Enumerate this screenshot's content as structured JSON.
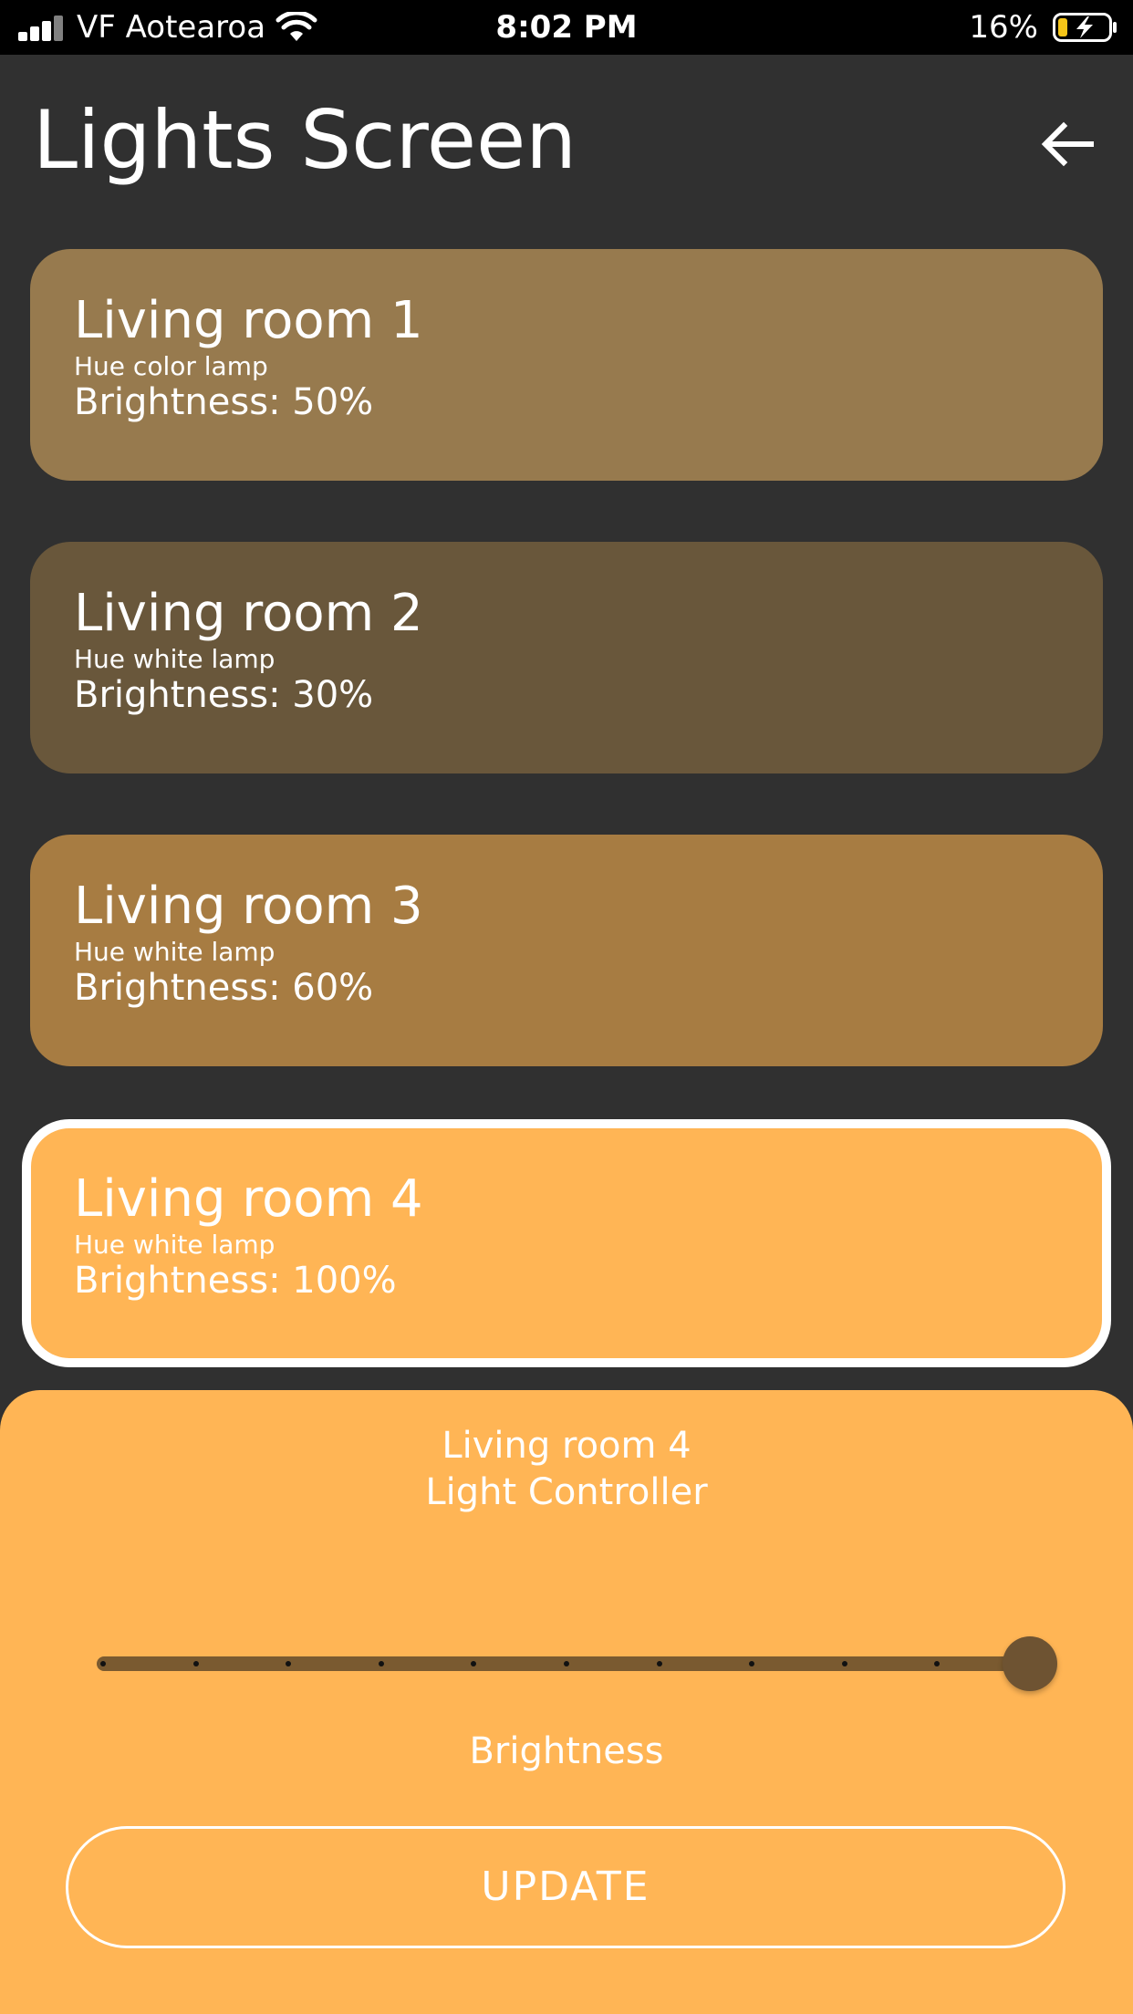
{
  "status_bar": {
    "carrier": "VF Aotearoa",
    "time": "8:02 PM",
    "battery_percent": "16%",
    "icons": [
      "signal-icon",
      "wifi-icon",
      "battery-charging-icon"
    ]
  },
  "header": {
    "title": "Lights Screen",
    "back_icon": "arrow-left-icon"
  },
  "lights": [
    {
      "name": "Living room 1",
      "type": "Hue color lamp",
      "brightness": "Brightness: 50%",
      "color": "#977a4e",
      "selected": false
    },
    {
      "name": "Living room 2",
      "type": "Hue white lamp",
      "brightness": "Brightness: 30%",
      "color": "#69573b",
      "selected": false
    },
    {
      "name": "Living room 3",
      "type": "Hue white lamp",
      "brightness": "Brightness: 60%",
      "color": "#a77c42",
      "selected": false
    },
    {
      "name": "Living room 4",
      "type": "Hue white lamp",
      "brightness": "Brightness: 100%",
      "color": "#ffb555",
      "selected": true
    }
  ],
  "controller": {
    "title_line1": "Living room 4",
    "title_line2": "Light Controller",
    "slider_label": "Brightness",
    "slider_value": 1.0,
    "slider_divisions": 10,
    "update_label": "UPDATE"
  },
  "colors": {
    "background": "#303030",
    "accent": "#ffb555"
  }
}
